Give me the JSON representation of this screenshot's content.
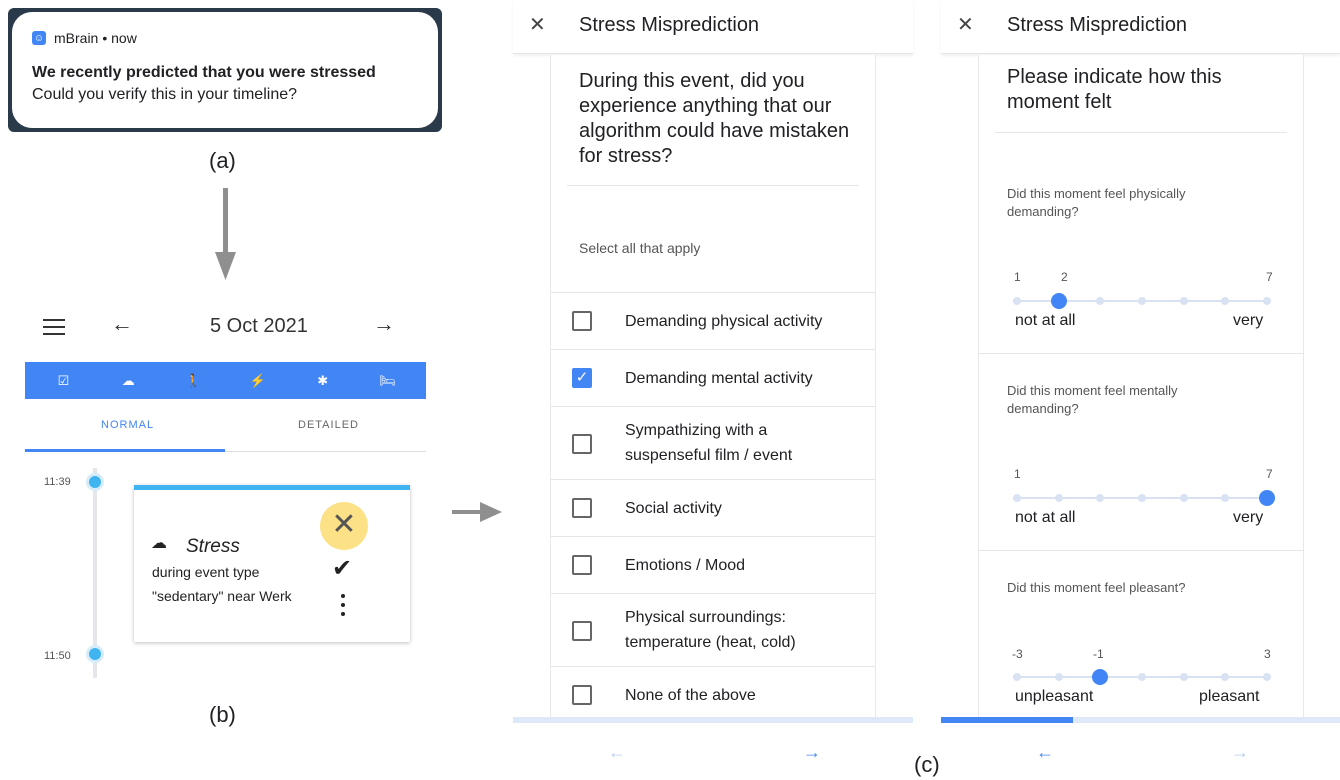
{
  "panel_a": {
    "app_name": "mBrain",
    "time": "• now",
    "title": "We recently predicted that you were stressed",
    "body": "Could you verify this in your timeline?",
    "caption": "(a)"
  },
  "panel_b": {
    "caption": "(b)",
    "date": "5 Oct 2021",
    "icon_bar": [
      "☑",
      "☁",
      "🚶",
      "⚡",
      "✱",
      "🛏"
    ],
    "tabs": {
      "normal": "NORMAL",
      "detailed": "DETAILED"
    },
    "times": [
      "11:39",
      "11:50"
    ],
    "event": {
      "title": "Stress",
      "line1": "during event type",
      "line2": "\"sedentary\" near Werk"
    }
  },
  "panel_c": {
    "caption": "(c)",
    "screen1": {
      "title": "Stress Misprediction",
      "question": "During this event, did you experience anything that our algorithm could have mistaken for stress?",
      "hint": "Select all that apply",
      "options": [
        {
          "label": "Demanding physical activity",
          "checked": false
        },
        {
          "label": "Demanding mental activity",
          "checked": true
        },
        {
          "label": "Sympathizing with a suspenseful film / event",
          "checked": false
        },
        {
          "label": "Social activity",
          "checked": false
        },
        {
          "label": "Emotions / Mood",
          "checked": false
        },
        {
          "label": "Physical surroundings: temperature (heat, cold)",
          "checked": false
        },
        {
          "label": "None of the above",
          "checked": false
        }
      ]
    },
    "screen2": {
      "title": "Stress Misprediction",
      "heading": "Please indicate how this moment felt",
      "progress": 0.33,
      "questions": [
        {
          "text": "Did this moment feel physically demanding?",
          "min_tick": "1",
          "sel_tick": "2",
          "max_tick": "7",
          "selected_index": 1,
          "low_label": "not at all",
          "high_label": "very"
        },
        {
          "text": "Did this moment feel mentally demanding?",
          "min_tick": "1",
          "sel_tick": "",
          "max_tick": "7",
          "selected_index": 6,
          "low_label": "not at all",
          "high_label": "very"
        },
        {
          "text": "Did this moment feel pleasant?",
          "min_tick": "-3",
          "sel_tick": "-1",
          "max_tick": "3",
          "selected_index": 2,
          "low_label": "unpleasant",
          "high_label": "pleasant"
        }
      ]
    },
    "nav": {
      "prev": "←",
      "next": "→"
    }
  },
  "colors": {
    "accent": "#4285f4",
    "timeline": "#3fb4f0",
    "highlight": "#fce186"
  }
}
